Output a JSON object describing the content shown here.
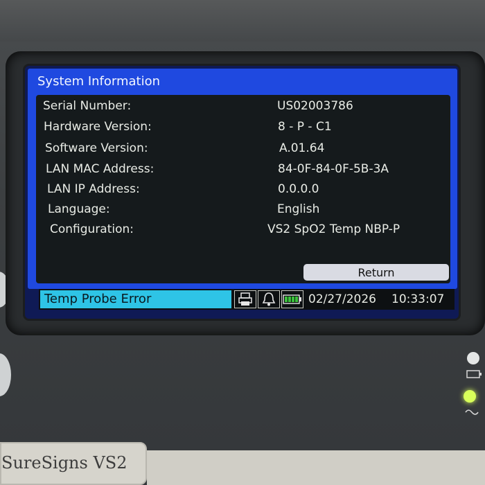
{
  "window": {
    "title": "System Information"
  },
  "info_rows": [
    {
      "label": "Serial Number:",
      "value": "US02003786"
    },
    {
      "label": "Hardware Version:",
      "value": "8 - P - C1"
    },
    {
      "label": "Software Version:",
      "value": "A.01.64"
    },
    {
      "label": "LAN MAC Address:",
      "value": "84-0F-84-0F-5B-3A"
    },
    {
      "label": "LAN IP Address:",
      "value": "0.0.0.0"
    },
    {
      "label": "Language:",
      "value": "English"
    },
    {
      "label": "Configuration:",
      "value": "VS2 SpO2 Temp NBP-P"
    }
  ],
  "return_label": "Return",
  "status_bar": {
    "alarm_message": "Temp Probe Error",
    "date": "02/27/2026",
    "time": "10:33:07",
    "icons": [
      "printer-icon",
      "bell-icon",
      "battery-icon"
    ]
  },
  "device": {
    "brand": "SureSigns VS2"
  },
  "colors": {
    "title_bar": "#1f49e0",
    "panel": "#151a1c",
    "alarm_bg": "#2ec4e6",
    "battery": "#3cc23c",
    "led_power": "#d8ff5a"
  }
}
